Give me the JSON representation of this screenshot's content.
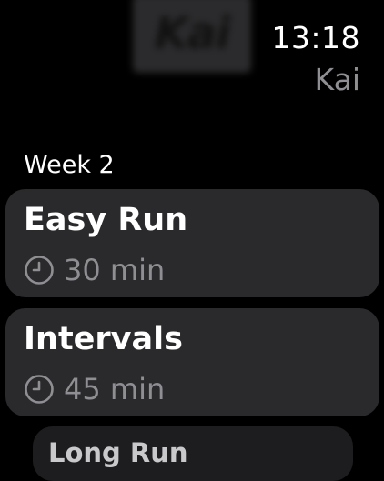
{
  "header": {
    "avatar_text": "Kai",
    "time": "13:18",
    "app_name": "Kai"
  },
  "section": {
    "title": "Week 2"
  },
  "workouts": [
    {
      "title": "Easy Run",
      "duration": "30 min",
      "icon": "clock-icon"
    },
    {
      "title": "Intervals",
      "duration": "45 min",
      "icon": "clock-icon"
    },
    {
      "title": "Long Run"
    }
  ],
  "colors": {
    "background": "#000000",
    "card": "#2a2a2c",
    "secondary_text": "#8e8e93",
    "primary_text": "#ffffff"
  }
}
